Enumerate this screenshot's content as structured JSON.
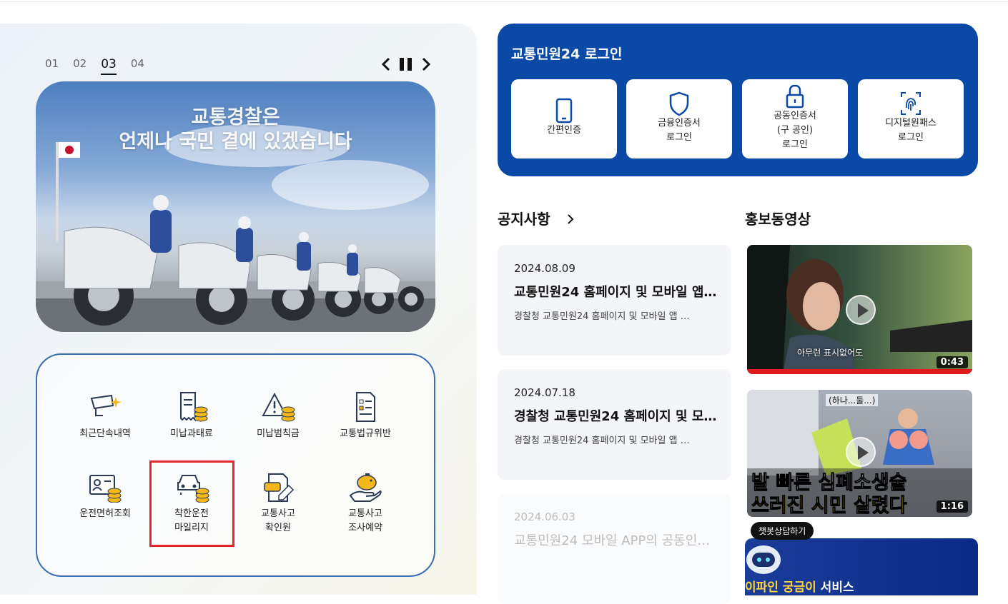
{
  "slider": {
    "pages": [
      "01",
      "02",
      "03",
      "04"
    ],
    "active_page": "03",
    "banner_line1": "교통경찰은",
    "banner_line2": "언제나 국민 곁에 있겠습니다",
    "prev_icon": "chevron-left-icon",
    "pause_icon": "pause-icon",
    "next_icon": "chevron-right-icon"
  },
  "quick_menu": {
    "items": [
      {
        "label": "최근단속내역",
        "icon": "camera-enforcement-icon"
      },
      {
        "label": "미납과태료",
        "icon": "receipt-coins-icon"
      },
      {
        "label": "미납범칙금",
        "icon": "warning-coins-icon"
      },
      {
        "label": "교통법규위반",
        "icon": "checklist-document-icon"
      },
      {
        "label": "운전면허조회",
        "icon": "license-card-icon"
      },
      {
        "label_line1": "착한운전",
        "label_line2": "마일리지",
        "icon": "car-coins-icon",
        "highlighted": true
      },
      {
        "label_line1": "교통사고",
        "label_line2": "확인원",
        "icon": "accident-certificate-icon"
      },
      {
        "label_line1": "교통사고",
        "label_line2": "조사예약",
        "icon": "piggy-bank-icon"
      }
    ]
  },
  "login": {
    "title": "교통민원24 로그인",
    "options": [
      {
        "line1": "간편인증",
        "icon": "mobile-phone-icon"
      },
      {
        "line1": "금융인증서",
        "line2": "로그인",
        "icon": "shield-icon"
      },
      {
        "line1": "공동인증서",
        "line2": "(구 공인)",
        "line3": "로그인",
        "icon": "lock-icon"
      },
      {
        "line1": "디지털원패스",
        "line2": "로그인",
        "icon": "fingerprint-icon"
      }
    ]
  },
  "notices": {
    "title": "공지사항",
    "more_icon": "chevron-right-icon",
    "items": [
      {
        "date": "2024.08.09",
        "title": "교통민원24 홈페이지 및 모바일 앱 …",
        "desc": "경찰청 교통민원24 홈페이지 및 모바일 앱 …"
      },
      {
        "date": "2024.07.18",
        "title": "경찰청 교통민원24 홈페이지 및 모…",
        "desc": "경찰청 교통민원24 홈페이지 및 모바일 앱 …"
      },
      {
        "date": "2024.06.03",
        "title": "교통민원24 모바일 APP의 공동인…",
        "desc": ""
      }
    ]
  },
  "videos": {
    "title": "홍보동영상",
    "items": [
      {
        "duration": "0:43",
        "caption": "아무런 표시없어도"
      },
      {
        "duration": "1:16",
        "overlay_line1": "발 빠른 심폐소생술",
        "overlay_line2": "쓰러진 시민 살렸다",
        "top_text": "(하나...둘...)"
      }
    ]
  },
  "chatbot": {
    "bubble": "챗봇상담하기",
    "service_highlight": "이파인 궁금이",
    "service_rest": " 서비스"
  }
}
